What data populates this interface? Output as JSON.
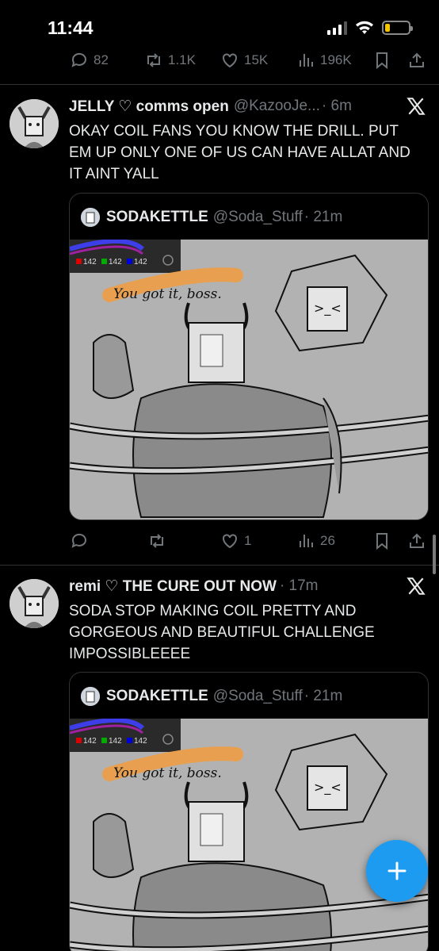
{
  "status_bar": {
    "time": "11:44"
  },
  "top_actions": {
    "replies": "82",
    "reposts": "1.1K",
    "likes": "15K",
    "views": "196K"
  },
  "tweets": [
    {
      "name": "JELLY ♡ comms open",
      "handle": "@KazooJe...",
      "time": "· 6m",
      "text": "OKAY COIL FANS YOU KNOW THE DRILL. PUT EM UP ONLY ONE OF US CAN HAVE ALLAT AND IT AINT YALL",
      "quote": {
        "name": "SODAKETTLE",
        "handle": "@Soda_Stuff",
        "time": "· 21m",
        "image_caption": "You got it, boss.",
        "color_readout": [
          "142",
          "142",
          "142"
        ]
      },
      "actions": {
        "replies": "",
        "reposts": "",
        "likes": "1",
        "views": "26"
      }
    },
    {
      "name": "remi ♡ THE CURE OUT NOW",
      "handle": "",
      "time": "· 17m",
      "text": "SODA STOP MAKING COIL PRETTY AND GORGEOUS AND BEAUTIFUL CHALLENGE IMPOSSIBLEEEE",
      "quote": {
        "name": "SODAKETTLE",
        "handle": "@Soda_Stuff",
        "time": "· 21m",
        "image_caption": "You got it, boss.",
        "color_readout": [
          "142",
          "142",
          "142"
        ]
      }
    }
  ],
  "colors": {
    "accent": "#1d9bf0",
    "background": "#000000",
    "muted": "#71767b",
    "text": "#e7e9ea"
  },
  "fab": {
    "icon": "plus-icon"
  }
}
